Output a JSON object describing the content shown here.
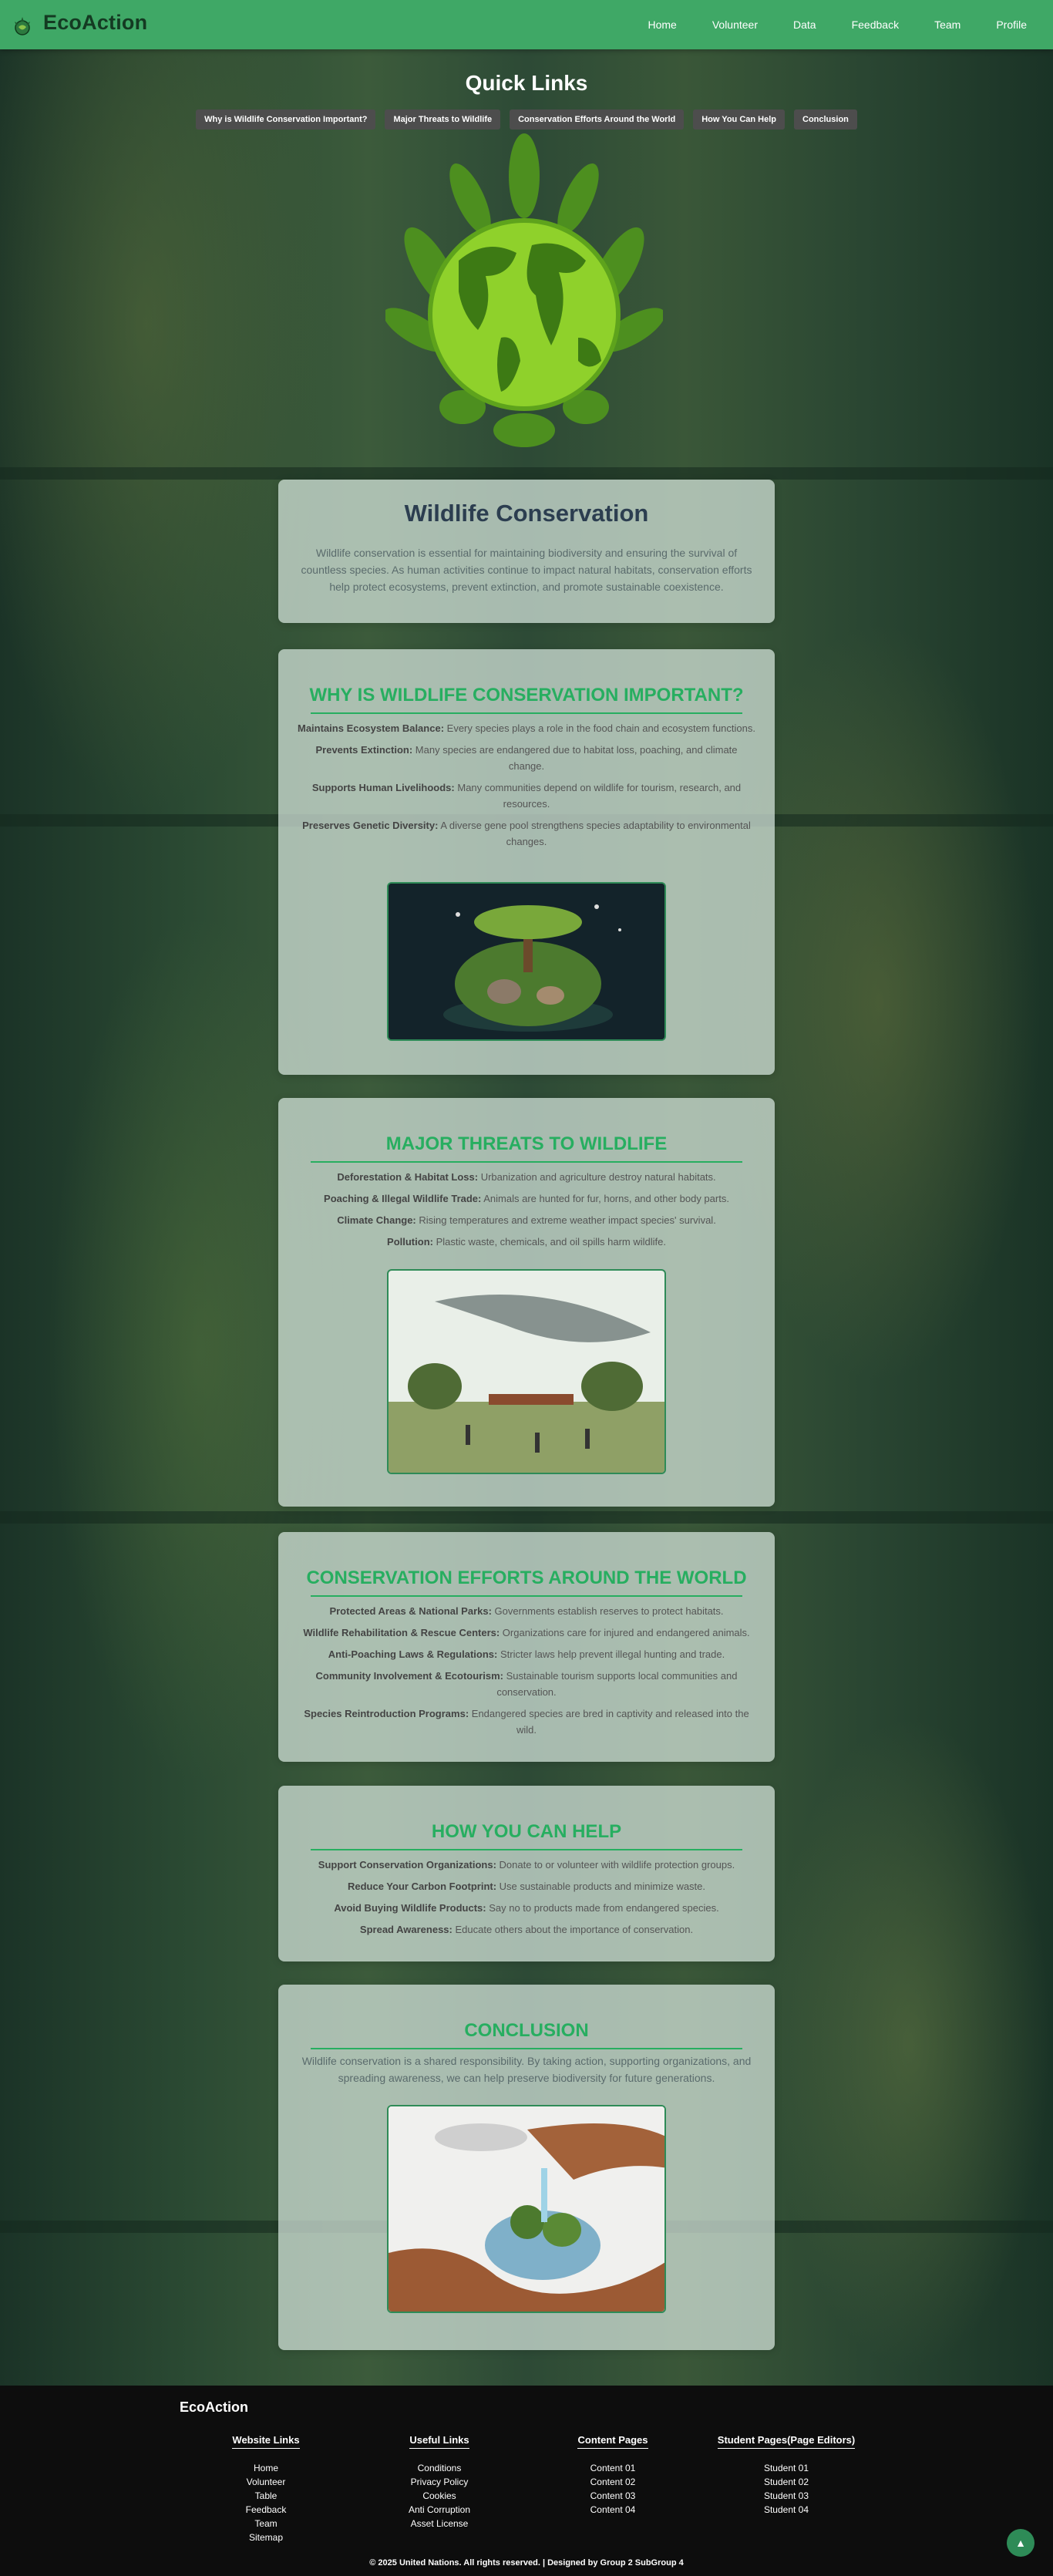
{
  "brand": "EcoAction",
  "nav": [
    "Home",
    "Volunteer",
    "Data",
    "Feedback",
    "Team",
    "Profile"
  ],
  "quick_links": {
    "title": "Quick Links",
    "items": [
      "Why is Wildlife Conservation Important?",
      "Major Threats to Wildlife",
      "Conservation Efforts Around the World",
      "How You Can Help",
      "Conclusion"
    ]
  },
  "intro": {
    "title": "Wildlife Conservation",
    "text": "Wildlife conservation is essential for maintaining biodiversity and ensuring the survival of countless species. As human activities continue to impact natural habitats, conservation efforts help protect ecosystems, prevent extinction, and promote sustainable coexistence."
  },
  "importance": {
    "title": "Why is Wildlife Conservation Important?",
    "items": [
      {
        "label": "Maintains Ecosystem Balance:",
        "text": " Every species plays a role in the food chain and ecosystem functions."
      },
      {
        "label": "Prevents Extinction:",
        "text": " Many species are endangered due to habitat loss, poaching, and climate change."
      },
      {
        "label": "Supports Human Livelihoods:",
        "text": " Many communities depend on wildlife for tourism, research, and resources."
      },
      {
        "label": "Preserves Genetic Diversity:",
        "text": " A diverse gene pool strengthens species adaptability to environmental changes."
      }
    ]
  },
  "threats": {
    "title": "Major Threats to Wildlife",
    "items": [
      {
        "label": "Deforestation & Habitat Loss:",
        "text": " Urbanization and agriculture destroy natural habitats."
      },
      {
        "label": "Poaching & Illegal Wildlife Trade:",
        "text": " Animals are hunted for fur, horns, and other body parts."
      },
      {
        "label": "Climate Change:",
        "text": " Rising temperatures and extreme weather impact species' survival."
      },
      {
        "label": "Pollution:",
        "text": " Plastic waste, chemicals, and oil spills harm wildlife."
      }
    ]
  },
  "efforts": {
    "title": "Conservation Efforts Around the World",
    "items": [
      {
        "label": "Protected Areas & National Parks:",
        "text": " Governments establish reserves to protect habitats."
      },
      {
        "label": "Wildlife Rehabilitation & Rescue Centers:",
        "text": " Organizations care for injured and endangered animals."
      },
      {
        "label": "Anti-Poaching Laws & Regulations:",
        "text": " Stricter laws help prevent illegal hunting and trade."
      },
      {
        "label": "Community Involvement & Ecotourism:",
        "text": " Sustainable tourism supports local communities and conservation."
      },
      {
        "label": "Species Reintroduction Programs:",
        "text": " Endangered species are bred in captivity and released into the wild."
      }
    ]
  },
  "help": {
    "title": "How You Can Help",
    "items": [
      {
        "label": "Support Conservation Organizations:",
        "text": " Donate to or volunteer with wildlife protection groups."
      },
      {
        "label": "Reduce Your Carbon Footprint:",
        "text": " Use sustainable products and minimize waste."
      },
      {
        "label": "Avoid Buying Wildlife Products:",
        "text": " Say no to products made from endangered species."
      },
      {
        "label": "Spread Awareness:",
        "text": " Educate others about the importance of conservation."
      }
    ]
  },
  "conclusion": {
    "title": "Conclusion",
    "text": "Wildlife conservation is a shared responsibility. By taking action, supporting organizations, and spreading awareness, we can help preserve biodiversity for future generations."
  },
  "footer": {
    "brand": "EcoAction",
    "columns": [
      {
        "title": "Website Links",
        "links": [
          "Home",
          "Volunteer",
          "Table",
          "Feedback",
          "Team",
          "Sitemap"
        ]
      },
      {
        "title": "Useful Links",
        "links": [
          "Conditions",
          "Privacy Policy",
          "Cookies",
          "Anti Corruption",
          "Asset License"
        ]
      },
      {
        "title": "Content Pages",
        "links": [
          "Content 01",
          "Content 02",
          "Content 03",
          "Content 04"
        ]
      },
      {
        "title": "Student Pages(Page Editors)",
        "links": [
          "Student 01",
          "Student 02",
          "Student 03",
          "Student 04"
        ]
      }
    ],
    "copyright": "© 2025 United Nations. All rights reserved. | Designed by Group 2 SubGroup 4"
  },
  "back_to_top": "▲",
  "colors": {
    "nav": "#3fa866",
    "accent": "#27ae60",
    "footer": "#0d0d0d"
  }
}
